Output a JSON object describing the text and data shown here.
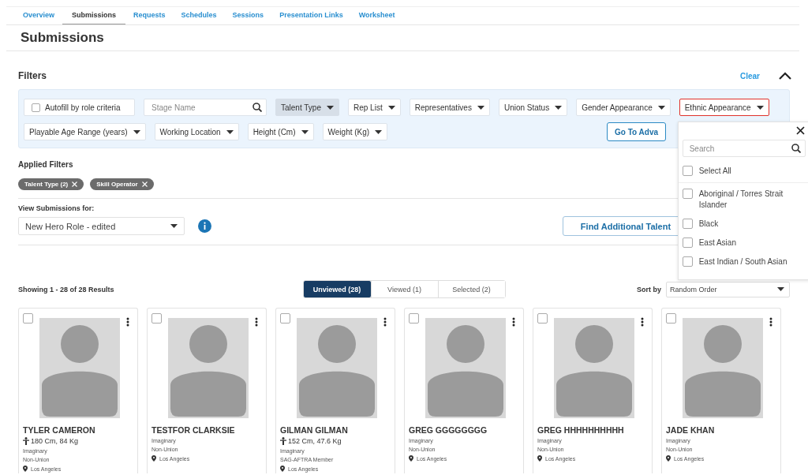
{
  "tabs": [
    {
      "label": "Overview",
      "selected": false
    },
    {
      "label": "Submissions",
      "selected": true
    },
    {
      "label": "Requests",
      "selected": false
    },
    {
      "label": "Schedules",
      "selected": false
    },
    {
      "label": "Sessions",
      "selected": false
    },
    {
      "label": "Presentation Links",
      "selected": false
    },
    {
      "label": "Worksheet",
      "selected": false
    }
  ],
  "title": "Submissions",
  "filters": {
    "title": "Filters",
    "clear": "Clear",
    "autofill": {
      "label": "Autofill by role criteria",
      "checked": false
    },
    "search": {
      "placeholder": "Stage Name"
    },
    "primary": [
      {
        "label": "Talent Type",
        "applied": true,
        "open": false
      },
      {
        "label": "Rep List",
        "applied": false,
        "open": false
      },
      {
        "label": "Representatives",
        "applied": false,
        "open": false
      },
      {
        "label": "Union Status",
        "applied": false,
        "open": false
      },
      {
        "label": "Gender Appearance",
        "applied": false,
        "open": false
      },
      {
        "label": "Ethnic Appearance",
        "applied": false,
        "open": true
      }
    ],
    "secondary": [
      {
        "label": "Playable Age Range (years)",
        "applied": false,
        "open": false
      },
      {
        "label": "Working Location",
        "applied": false,
        "open": false
      },
      {
        "label": "Height (Cm)",
        "applied": false,
        "open": false
      },
      {
        "label": "Weight (Kg)",
        "applied": false,
        "open": false
      }
    ],
    "advanced_button": "Go To Adva"
  },
  "popover": {
    "search_placeholder": "Search",
    "select_all": {
      "label": "Select All",
      "checked": false
    },
    "options": [
      {
        "label": "Aboriginal / Torres Strait Islander",
        "checked": false
      },
      {
        "label": "Black",
        "checked": false
      },
      {
        "label": "East Asian",
        "checked": false
      },
      {
        "label": "East Indian / South Asian",
        "checked": false
      }
    ]
  },
  "applied_filters": {
    "title": "Applied Filters",
    "chips": [
      "Talent Type (2)",
      "Skill Operator"
    ]
  },
  "view_for": {
    "label": "View Submissions for:",
    "value": "New Hero Role - edited"
  },
  "find_button": "Find Additional Talent",
  "results": {
    "summary": "Showing 1 - 28 of 28 Results",
    "segments": [
      {
        "label": "Unviewed (28)",
        "selected": true
      },
      {
        "label": "Viewed (1)",
        "selected": false
      },
      {
        "label": "Selected (2)",
        "selected": false
      }
    ],
    "sort_label": "Sort by",
    "sort_value": "Random Order"
  },
  "cards": [
    {
      "name": "TYLER CAMERON",
      "checked": false,
      "measurements": "180 Cm, 84 Kg",
      "lines": [
        "Imaginary",
        "Non-Union"
      ],
      "location": "Los Angeles"
    },
    {
      "name": "TESTFOR CLARKSIE",
      "checked": false,
      "lines": [
        "Imaginary",
        "Non-Union"
      ],
      "location": "Los Angeles"
    },
    {
      "name": "GILMAN GILMAN",
      "checked": false,
      "measurements": "152 Cm, 47.6 Kg",
      "lines": [
        "Imaginary",
        "SAG-AFTRA Member"
      ],
      "location": "Los Angeles"
    },
    {
      "name": "GREG GGGGGGGG",
      "checked": false,
      "lines": [
        "Imaginary",
        "Non-Union"
      ],
      "location": "Los Angeles"
    },
    {
      "name": "GREG HHHHHHHHHH",
      "checked": false,
      "lines": [
        "Imaginary",
        "Non-Union"
      ],
      "location": "Los Angeles"
    },
    {
      "name": "JADE KHAN",
      "checked": false,
      "lines": [
        "Imaginary",
        "Non-Union"
      ],
      "location": "Los Angeles"
    }
  ]
}
